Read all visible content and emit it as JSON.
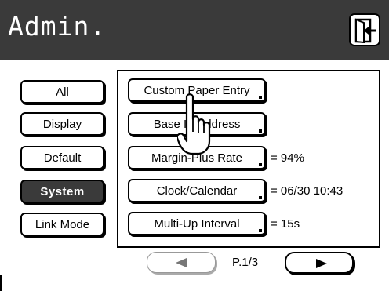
{
  "header": {
    "title": "Admin.",
    "exit_icon": "exit-door-icon",
    "background": "#3a3a3a"
  },
  "categories": [
    {
      "label": "All",
      "active": false
    },
    {
      "label": "Display",
      "active": false
    },
    {
      "label": "Default",
      "active": false
    },
    {
      "label": "System",
      "active": true
    },
    {
      "label": "Link Mode",
      "active": false
    }
  ],
  "settings": [
    {
      "label": "Custom Paper Entry",
      "value": ""
    },
    {
      "label": "Base IP Address",
      "value": ""
    },
    {
      "label": "Margin-Plus Rate",
      "value": "= 94%"
    },
    {
      "label": "Clock/Calendar",
      "value": "= 06/30  10:43"
    },
    {
      "label": "Multi-Up Interval",
      "value": "= 15s"
    }
  ],
  "pagination": {
    "page": "P.1/3",
    "prev_icon": "triangle-left-icon",
    "next_icon": "triangle-right-icon",
    "prev_enabled": false
  },
  "cursor_icon": "hand-pointer-icon"
}
